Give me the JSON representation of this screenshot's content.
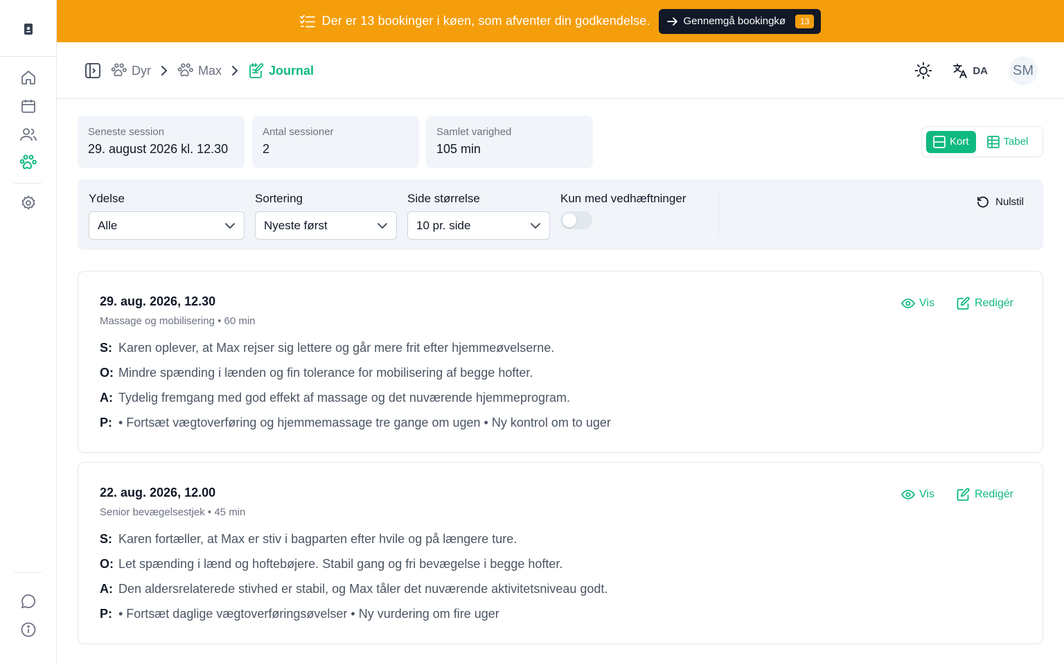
{
  "banner": {
    "text": "Der er 13 bookinger i køen, som afventer din godkendelse.",
    "button_label": "Gennemgå bookingkø",
    "badge": "13",
    "color": "#f59e0b"
  },
  "sidebar": {
    "items": [
      {
        "icon": "home-icon"
      },
      {
        "icon": "calendar-icon"
      },
      {
        "icon": "users-icon"
      },
      {
        "icon": "paw-icon",
        "active": true
      },
      {
        "icon": "settings-icon"
      }
    ],
    "bottom": [
      {
        "icon": "chat-icon"
      },
      {
        "icon": "info-icon"
      }
    ]
  },
  "breadcrumb": {
    "items": [
      {
        "label": "Dyr",
        "icon": "paw-icon"
      },
      {
        "label": "Max",
        "icon": "paw-icon"
      },
      {
        "label": "Journal",
        "icon": "journal-icon",
        "active": true
      }
    ]
  },
  "header": {
    "language": "DA",
    "avatar_initials": "SM"
  },
  "stats": [
    {
      "label": "Seneste session",
      "value": "29. august 2026 kl. 12.30"
    },
    {
      "label": "Antal sessioner",
      "value": "2"
    },
    {
      "label": "Samlet varighed",
      "value": "105 min"
    }
  ],
  "view_toggle": {
    "card_label": "Kort",
    "table_label": "Tabel",
    "selected": "Kort"
  },
  "filters": {
    "service": {
      "label": "Ydelse",
      "value": "Alle"
    },
    "sort": {
      "label": "Sortering",
      "value": "Nyeste først"
    },
    "page_size": {
      "label": "Side størrelse",
      "value": "10 pr. side"
    },
    "attachments": {
      "label": "Kun med vedhæftninger",
      "on": false
    },
    "reset_label": "Nulstil"
  },
  "entries": [
    {
      "date": "29. aug. 2026, 12.30",
      "subtitle": "Massage og mobilisering • 60 min",
      "view_label": "Vis",
      "edit_label": "Redigér",
      "S": "Karen oplever, at Max rejser sig lettere og går mere frit efter hjemmeøvelserne.",
      "O": "Mindre spænding i lænden og fin tolerance for mobilisering af begge hofter.",
      "A": "Tydelig fremgang med god effekt af massage og det nuværende hjemmeprogram.",
      "P": "• Fortsæt vægtoverføring og hjemmemassage tre gange om ugen • Ny kontrol om to uger"
    },
    {
      "date": "22. aug. 2026, 12.00",
      "subtitle": "Senior bevægelsestjek • 45 min",
      "view_label": "Vis",
      "edit_label": "Redigér",
      "S": "Karen fortæller, at Max er stiv i bagparten efter hvile og på længere ture.",
      "O": "Let spænding i lænd og hoftebøjere. Stabil gang og fri bevægelse i begge hofter.",
      "A": "Den aldersrelaterede stivhed er stabil, og Max tåler det nuværende aktivitetsniveau godt.",
      "P": "• Fortsæt daglige vægtoverføringsøvelser • Ny vurdering om fire uger"
    }
  ],
  "soap_keys": {
    "S": "S:",
    "O": "O:",
    "A": "A:",
    "P": "P:"
  },
  "colors": {
    "accent": "#10b981",
    "banner": "#f59e0b",
    "dark": "#111827"
  }
}
